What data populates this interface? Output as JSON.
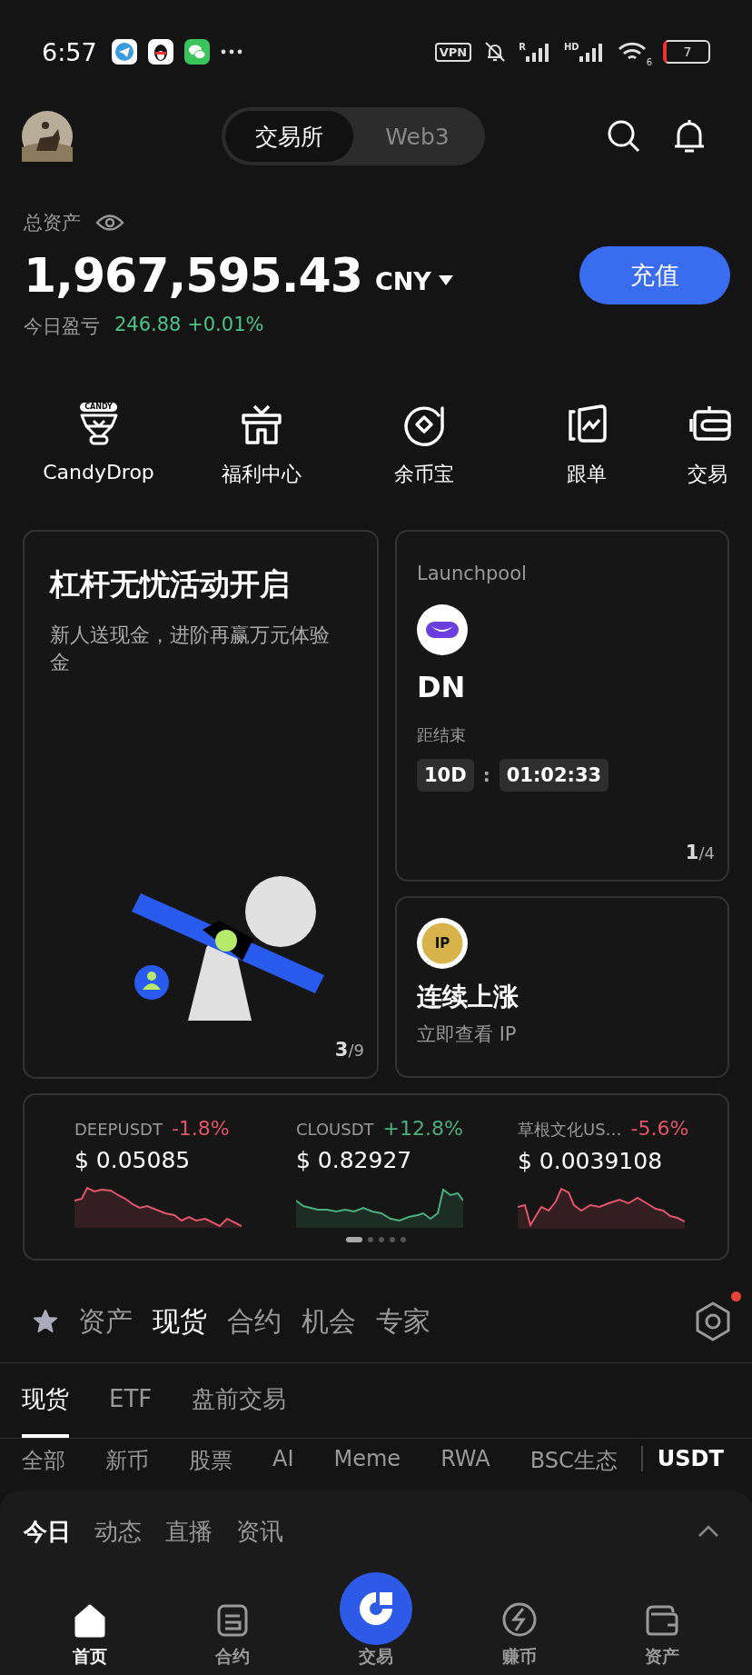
{
  "status_bar": {
    "time": "6:57",
    "vpn": "VPN",
    "signal_labels": [
      "R",
      "HD"
    ],
    "wifi_label": "6",
    "battery": "7"
  },
  "header": {
    "tabs": [
      {
        "label": "交易所",
        "selected": true
      },
      {
        "label": "Web3",
        "selected": false
      }
    ]
  },
  "assets": {
    "label": "总资产",
    "amount": "1,967,595.43",
    "currency": "CNY",
    "deposit_button": "充值",
    "pnl_label": "今日盈亏",
    "pnl_value": "246.88 +0.01%"
  },
  "shortcuts": [
    {
      "kind": "candy",
      "label": "CandyDrop",
      "badge": "CANDY"
    },
    {
      "kind": "gift",
      "label": "福利中心"
    },
    {
      "kind": "coin",
      "label": "余币宝"
    },
    {
      "kind": "copy",
      "label": "跟单"
    },
    {
      "kind": "bot",
      "label": "交易"
    }
  ],
  "promo": {
    "title": "杠杆无忧活动开启",
    "subtitle": "新人送现金，进阶再赢万元体验金",
    "page": "3",
    "total": "/9"
  },
  "launchpool": {
    "label": "Launchpool",
    "token": "DN",
    "countdown_label": "距结束",
    "days": "10D",
    "separator": ":",
    "time": "01:02:33",
    "page": "1",
    "total": "/4"
  },
  "trend_card": {
    "badge": "IP",
    "title": "连续上涨",
    "subtitle": "立即查看 IP"
  },
  "tickers": [
    {
      "pair": "DEEPUSDT",
      "change": "-1.8%",
      "kind": "down",
      "price": "$ 0.05085"
    },
    {
      "pair": "CLOUSDT",
      "change": "+12.8%",
      "kind": "up",
      "price": "$ 0.82927"
    },
    {
      "pair": "草根文化US…",
      "change": "-5.6%",
      "kind": "down",
      "price": "$ 0.0039108"
    }
  ],
  "ticker_pages": [
    {
      "selected": true
    },
    {
      "selected": false
    },
    {
      "selected": false
    },
    {
      "selected": false
    },
    {
      "selected": false
    }
  ],
  "market_tabs": [
    {
      "label": "资产",
      "selected": false
    },
    {
      "label": "现货",
      "selected": true
    },
    {
      "label": "合约",
      "selected": false
    },
    {
      "label": "机会",
      "selected": false
    },
    {
      "label": "专家",
      "selected": false
    }
  ],
  "sub_tabs": [
    {
      "label": "现货",
      "selected": true
    },
    {
      "label": "ETF",
      "selected": false
    },
    {
      "label": "盘前交易",
      "selected": false
    }
  ],
  "categories": [
    "全部",
    "新币",
    "股票",
    "AI",
    "Meme",
    "RWA",
    "BSC生态"
  ],
  "quote_currency": "USDT",
  "feed_tabs": [
    {
      "label": "今日",
      "selected": true
    },
    {
      "label": "动态",
      "selected": false
    },
    {
      "label": "直播",
      "selected": false
    },
    {
      "label": "资讯",
      "selected": false
    }
  ],
  "bottom_nav": [
    {
      "kind": "home",
      "label": "首页",
      "selected": true
    },
    {
      "kind": "futures",
      "label": "合约",
      "selected": false
    },
    {
      "kind": "trade",
      "label": "交易",
      "selected": false
    },
    {
      "kind": "earn",
      "label": "赚币",
      "selected": false
    },
    {
      "kind": "wallet",
      "label": "资产",
      "selected": false
    }
  ]
}
